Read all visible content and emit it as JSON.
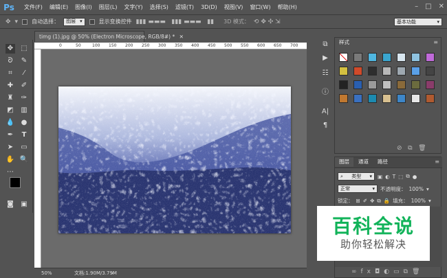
{
  "app": {
    "logo": "Ps"
  },
  "menu": [
    "文件(F)",
    "编辑(E)",
    "图像(I)",
    "图层(L)",
    "文字(Y)",
    "选择(S)",
    "滤镜(T)",
    "3D(D)",
    "视图(V)",
    "窗口(W)",
    "帮助(H)"
  ],
  "options": {
    "auto_select_label": "自动选择：",
    "auto_select_value": "图层",
    "show_transform_label": "显示变换控件",
    "mode_3d": "3D 模式：",
    "workspace": "基本功能"
  },
  "document": {
    "tab_title": "timg (1).jpg @ 50% (Electron Microscope, RGB/8#) *",
    "ruler_ticks": [
      "0",
      "50",
      "100",
      "150",
      "200",
      "250",
      "300",
      "350",
      "400",
      "450",
      "500",
      "550",
      "600",
      "650",
      "700"
    ],
    "zoom": "50%",
    "doc_info": "文档:1.90M/3.79M"
  },
  "styles_panel": {
    "tab_label": "样式",
    "swatch_colors": [
      "#ffffff",
      "#7a7a7a",
      "#4fb6e0",
      "#3aa6cf",
      "#d8e6ef",
      "#8fc3e0",
      "#c06ad9",
      "#d4c040",
      "#d04a2a",
      "#2e2e2e",
      "#b8b8b8",
      "#9ea8b0",
      "#5aa0e8",
      "#444444",
      "#232323",
      "#2a5fb0",
      "#9a9a9a",
      "#c0c0c0",
      "#8a6a3a",
      "#6b6b3e",
      "#8a3c6a",
      "#c07830",
      "#3a70c0",
      "#1c8ab0",
      "#d8c090",
      "#3d86c8",
      "#e8e8e8",
      "#b05a30"
    ]
  },
  "layers_panel": {
    "tabs": [
      "图层",
      "通道",
      "路径"
    ],
    "filter_label": "类型",
    "blend_mode": "正常",
    "opacity_label": "不透明度：",
    "opacity_value": "100%",
    "lock_label": "锁定：",
    "fill_label": "填充：",
    "fill_value": "100%"
  },
  "watermark": {
    "title": "百科全说",
    "subtitle": "助你轻松解决"
  },
  "icons": {
    "accent": "#5fb4f7",
    "watermark_green": "#12b35a"
  }
}
